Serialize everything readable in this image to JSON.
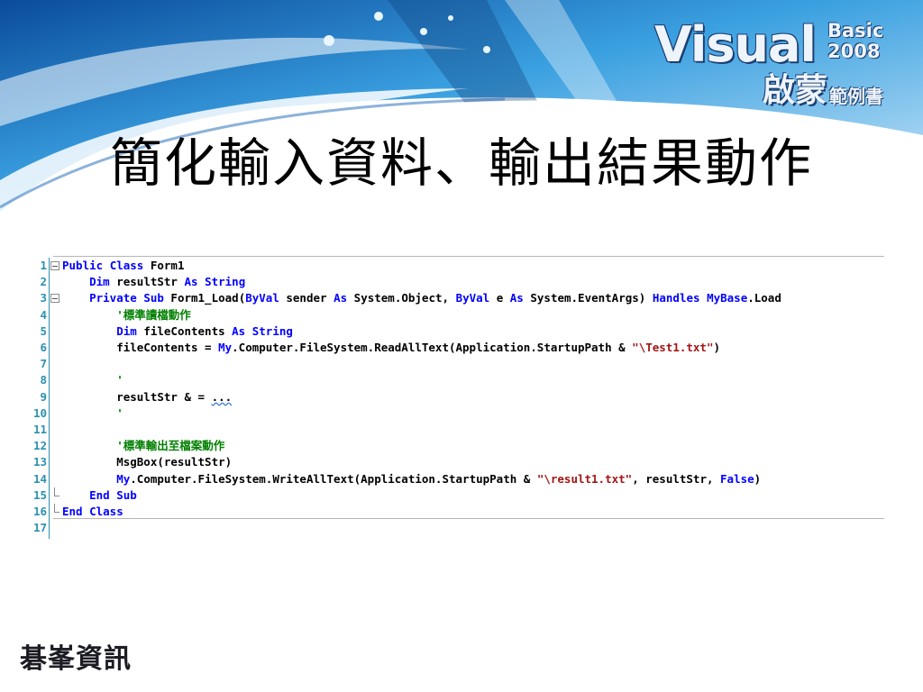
{
  "slide": {
    "title": "簡化輸入資料、輸出結果動作",
    "logo": {
      "visual": "Visual",
      "basic": "Basic",
      "year": "2008",
      "subtitle_big": "啟蒙",
      "subtitle_small": "範例書"
    },
    "publisher": "碁峯資訊"
  },
  "code_editor": {
    "lines": [
      {
        "number": "1",
        "fold": "open",
        "text": "Public Class Form1"
      },
      {
        "number": "2",
        "fold": "",
        "text": "    Dim resultStr As String"
      },
      {
        "number": "3",
        "fold": "open",
        "text": "    Private Sub Form1_Load(ByVal sender As System.Object, ByVal e As System.EventArgs) Handles MyBase.Load"
      },
      {
        "number": "4",
        "fold": "",
        "text": "        '標準讀檔動作"
      },
      {
        "number": "5",
        "fold": "",
        "text": "        Dim fileContents As String"
      },
      {
        "number": "6",
        "fold": "",
        "text": "        fileContents = My.Computer.FileSystem.ReadAllText(Application.StartupPath & \"\\Test1.txt\")"
      },
      {
        "number": "7",
        "fold": "",
        "text": ""
      },
      {
        "number": "8",
        "fold": "",
        "text": "        '"
      },
      {
        "number": "9",
        "fold": "",
        "text": "        resultStr & = ..."
      },
      {
        "number": "10",
        "fold": "",
        "text": "        '"
      },
      {
        "number": "11",
        "fold": "",
        "text": ""
      },
      {
        "number": "12",
        "fold": "",
        "text": "        '標準輸出至檔案動作"
      },
      {
        "number": "13",
        "fold": "",
        "text": "        MsgBox(resultStr)"
      },
      {
        "number": "14",
        "fold": "",
        "text": "        My.Computer.FileSystem.WriteAllText(Application.StartupPath & \"\\result1.txt\", resultStr, False)"
      },
      {
        "number": "15",
        "fold": "end",
        "text": "    End Sub"
      },
      {
        "number": "16",
        "fold": "end",
        "text": "End Class"
      },
      {
        "number": "17",
        "fold": "",
        "text": ""
      }
    ]
  },
  "colors": {
    "keyword": "#0000ff",
    "comment": "#008000",
    "string": "#a31515",
    "line_number": "#2b91af"
  }
}
